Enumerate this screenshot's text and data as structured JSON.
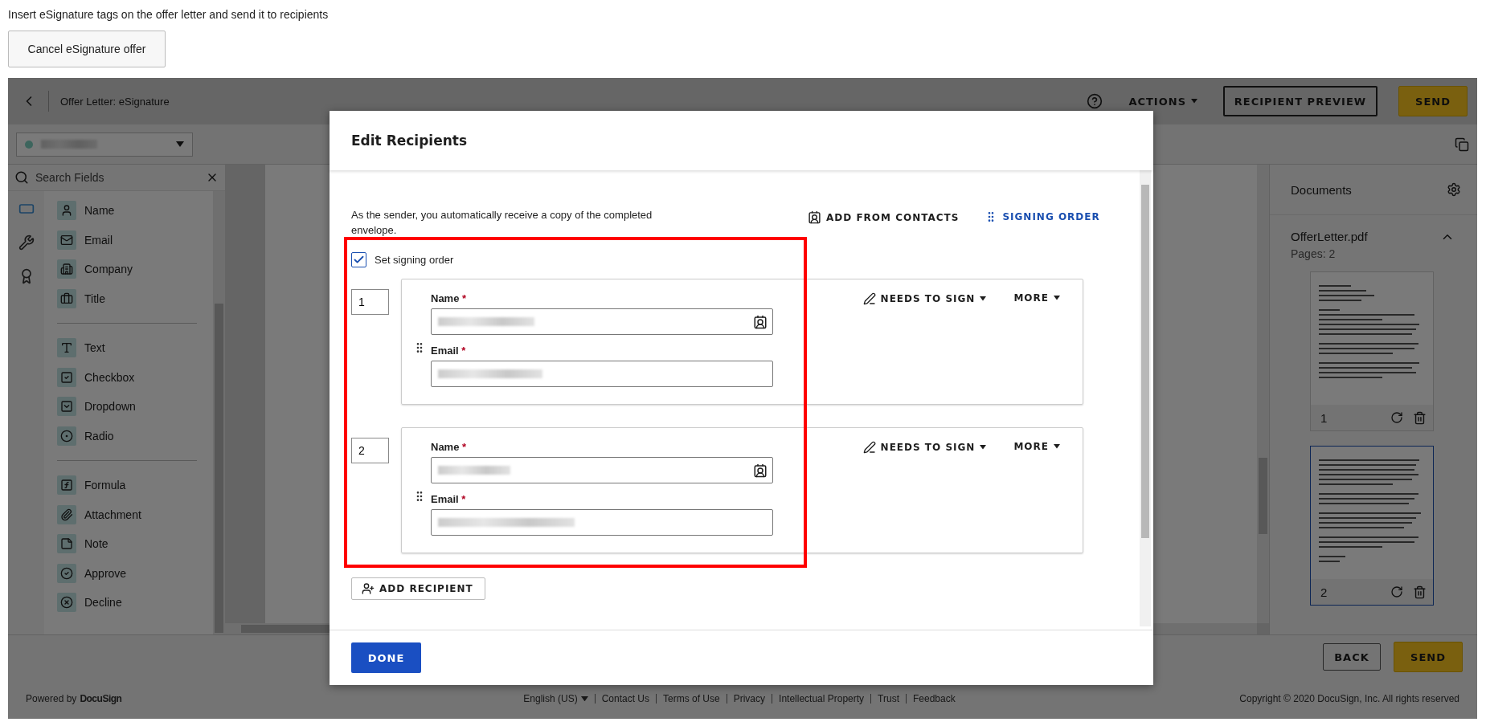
{
  "instruction": "Insert eSignature tags on the offer letter and send it to recipients",
  "cancel_button": "Cancel eSignature offer",
  "header": {
    "title": "Offer Letter: eSignature",
    "actions_menu": "ACTIONS",
    "preview_button": "RECIPIENT PREVIEW",
    "send_button": "SEND"
  },
  "rail": [
    {
      "selected": true
    },
    {
      "selected": false
    },
    {
      "selected": false
    }
  ],
  "field_search": {
    "placeholder": "Search Fields"
  },
  "field_groups": [
    [
      "Name",
      "Email",
      "Company",
      "Title"
    ],
    [
      "Text",
      "Checkbox",
      "Dropdown",
      "Radio"
    ],
    [
      "Formula",
      "Attachment",
      "Note",
      "Approve",
      "Decline"
    ]
  ],
  "documents": {
    "title": "Documents",
    "file": "OfferLetter.pdf",
    "pages_label": "Pages: 2",
    "pages": [
      {
        "number": "1",
        "selected": false
      },
      {
        "number": "2",
        "selected": true
      }
    ]
  },
  "action_bar": {
    "back_button": "BACK",
    "send_button": "SEND"
  },
  "footer": {
    "powered_by": "Powered by",
    "brand": "DocuSign",
    "language": "English (US)",
    "links": [
      "Contact Us",
      "Terms of Use",
      "Privacy",
      "Intellectual Property",
      "Trust",
      "Feedback"
    ],
    "copyright": "Copyright © 2020 DocuSign, Inc. All rights reserved"
  },
  "modal": {
    "title": "Edit Recipients",
    "note": "As the sender, you automatically receive a copy of the completed envelope.",
    "add_from_contacts": "ADD FROM CONTACTS",
    "signing_order": "SIGNING ORDER",
    "signing_order_checkbox": {
      "label": "Set signing order",
      "checked": true
    },
    "recipients": [
      {
        "order": "1",
        "fields": [
          {
            "kind": "name",
            "label": "Name",
            "required_mark": "*"
          },
          {
            "kind": "email",
            "label": "Email",
            "required_mark": "*"
          }
        ],
        "action": "NEEDS TO SIGN",
        "more": "MORE"
      },
      {
        "order": "2",
        "fields": [
          {
            "kind": "name",
            "label": "Name",
            "required_mark": "*"
          },
          {
            "kind": "email",
            "label": "Email",
            "required_mark": "*"
          }
        ],
        "action": "NEEDS TO SIGN",
        "more": "MORE"
      }
    ],
    "add_recipient": "ADD RECIPIENT",
    "done": "DONE"
  }
}
